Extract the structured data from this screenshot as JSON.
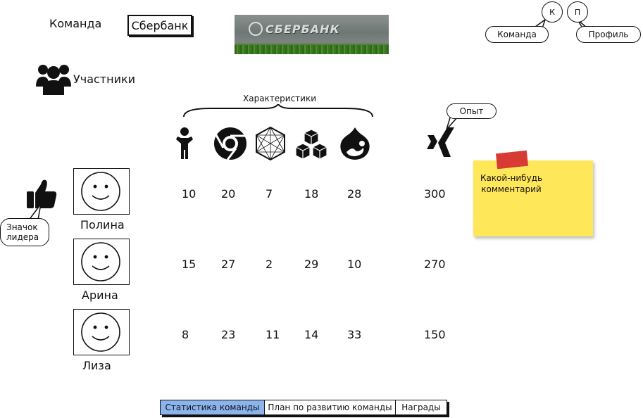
{
  "header": {
    "team_label": "Команда",
    "team_name": "Сбербанк",
    "logo_text": "СБЕРБАНК",
    "circle_k": "К",
    "circle_p": "П",
    "bubble_team": "Команда",
    "bubble_profile": "Профиль"
  },
  "members": {
    "label": "Участники",
    "characteristics_label": "Характеристики",
    "experience_bubble": "Опыт",
    "leader_bubble": "Значок лидера",
    "columns": [
      "person-icon",
      "chrome-icon",
      "geodesic-icon",
      "cubes-icon",
      "drupal-icon",
      "xing-icon"
    ],
    "rows": [
      {
        "name": "Полина",
        "values": [
          "10",
          "20",
          "7",
          "18",
          "28",
          "300"
        ]
      },
      {
        "name": "Арина",
        "values": [
          "15",
          "27",
          "2",
          "29",
          "10",
          "270"
        ]
      },
      {
        "name": "Лиза",
        "values": [
          "8",
          "23",
          "11",
          "14",
          "33",
          "150"
        ]
      }
    ]
  },
  "sticky": {
    "text": "Какой-нибудь комментарий",
    "color": "#ffe75a",
    "tape_color": "#d83a34"
  },
  "tabs": [
    {
      "label": "Статистика команды",
      "active": true
    },
    {
      "label": "План по развитию команды",
      "active": false
    },
    {
      "label": "Награды",
      "active": false
    }
  ],
  "colors": {
    "active_tab": "#8cb4ec"
  }
}
